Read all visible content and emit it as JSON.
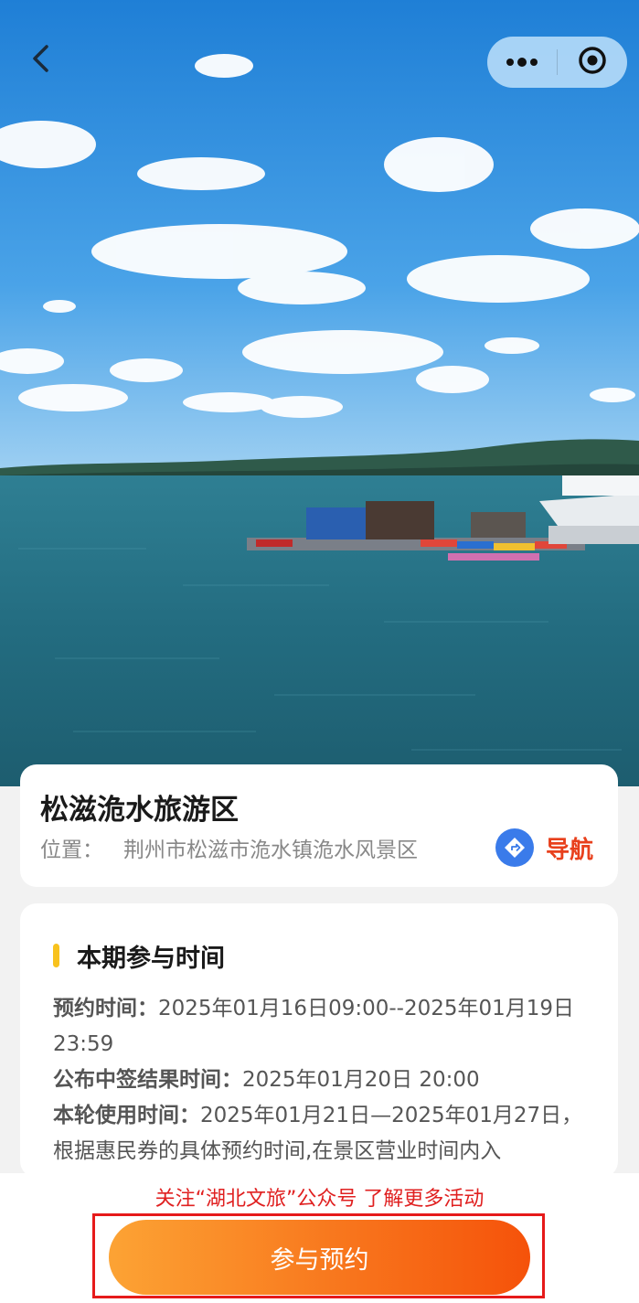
{
  "hero": {
    "image_description_icon": "lake-landscape-photo"
  },
  "top_bar": {
    "back_icon": "chevron-left-icon",
    "more_icon": "more-dots-icon",
    "close_icon": "target-circle-icon"
  },
  "scenic": {
    "title": "松滋洈水旅游区",
    "location_label": "位置：",
    "location_value": "荆州市松滋市洈水镇洈水风景区",
    "nav_label": "导航",
    "nav_icon": "navigation-arrow-icon"
  },
  "period": {
    "section_title": "本期参与时间",
    "booking_label": "预约时间：",
    "booking_value": "2025年01月16日09:00--2025年01月19日23:59",
    "result_label": "公布中签结果时间：",
    "result_value": "2025年01月20日 20:00",
    "usage_label": "本轮使用时间：",
    "usage_value": "2025年01月21日—2025年01月27日，根据惠民券的具体预约时间,在景区营业时间内入"
  },
  "footer": {
    "follow_tip": "关注“湖北文旅”公众号 了解更多活动",
    "book_button": "参与预约"
  },
  "colors": {
    "accent_red": "#e8401c",
    "button_gradient_start": "#fca334",
    "button_gradient_end": "#f5520a",
    "section_bar": "#f8c21e",
    "nav_icon_bg": "#3a7bea"
  }
}
